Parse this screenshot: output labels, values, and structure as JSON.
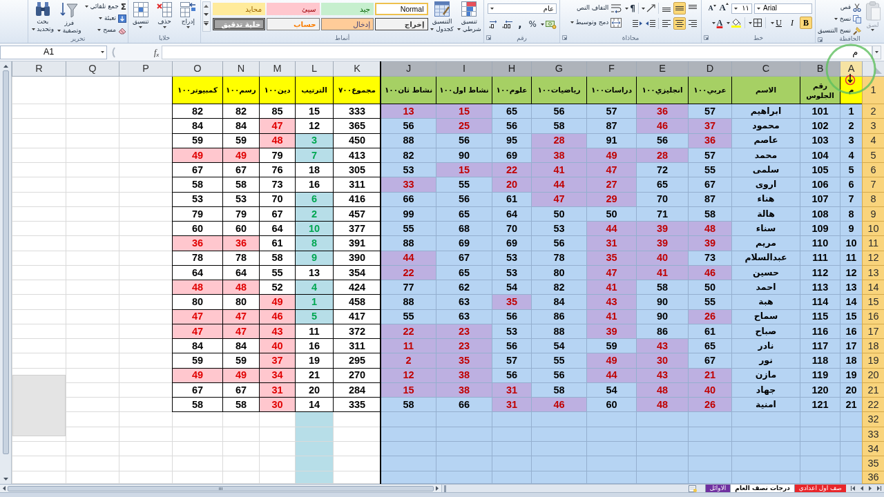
{
  "ribbon": {
    "clipboard": {
      "label": "الحافظة",
      "paste": {
        "label": "لصق",
        "disabled": true
      },
      "cut": "قص",
      "copy": "نسخ",
      "format_painter": "نسخ التنسيق"
    },
    "font": {
      "label": "خط",
      "font_name": "Arial",
      "font_size": "١١",
      "grow": "A",
      "shrink": "A",
      "bold": {
        "glyph": "B",
        "on": true
      },
      "italic": {
        "glyph": "I",
        "on": false
      },
      "underline": {
        "glyph": "U",
        "on": false
      },
      "font_color": "A"
    },
    "alignment": {
      "label": "محاذاة",
      "vertical": [
        {
          "kind": "top",
          "selected": false
        },
        {
          "kind": "middle",
          "selected": true
        },
        {
          "kind": "bottom",
          "selected": false
        }
      ],
      "horizontal": [
        {
          "kind": "right",
          "selected": false
        },
        {
          "kind": "center",
          "selected": true
        },
        {
          "kind": "left",
          "selected": false
        }
      ],
      "direction": "¶",
      "wrap_text": "التفاف النص",
      "merge_center": "دمج وتوسيط"
    },
    "number": {
      "label": "رقم",
      "format": "عام",
      "percent": "%",
      "comma": ","
    },
    "styles": {
      "label": "أنماط",
      "conditional_formatting": "تنسيق شرطي",
      "format_as_table": "التنسيق كجدول",
      "gallery": [
        {
          "label": "Normal",
          "kind": "normal",
          "selected": true
        },
        {
          "label": "جيد",
          "kind": "good",
          "selected": false
        },
        {
          "label": "سيئ",
          "kind": "bad",
          "selected": false
        },
        {
          "label": "محايد",
          "kind": "neutral",
          "selected": false
        },
        {
          "label": "إخراج",
          "kind": "output",
          "selected": false
        },
        {
          "label": "إدخال",
          "kind": "input",
          "selected": false
        },
        {
          "label": "حساب",
          "kind": "calculation",
          "selected": false
        },
        {
          "label": "خلية تدقيق",
          "kind": "check",
          "selected": false
        }
      ]
    },
    "cells": {
      "label": "خلايا",
      "insert": "إدراج",
      "delete": "حذف",
      "format": "تنسيق"
    },
    "editing": {
      "label": "تحرير",
      "autosum": {
        "glyph": "Σ",
        "label": "جمع تلقائي"
      },
      "fill": "تعبئة",
      "clear": "مسح",
      "sort_filter": "فرز وتصفية",
      "find_select": "بحث وتحديد"
    }
  },
  "formula_bar": {
    "name_box": "A1",
    "function_label": "f$_{x}$",
    "value": "م"
  },
  "sheet": {
    "columns": [
      {
        "letter": "A",
        "kind": "serial",
        "selected": true,
        "active": true
      },
      {
        "letter": "B",
        "kind": "info",
        "selected": true,
        "active": false
      },
      {
        "letter": "C",
        "kind": "name",
        "selected": true,
        "active": false
      },
      {
        "letter": "D",
        "kind": "subject",
        "selected": true,
        "active": false
      },
      {
        "letter": "E",
        "kind": "subject",
        "selected": true,
        "active": false
      },
      {
        "letter": "F",
        "kind": "subject",
        "selected": true,
        "active": false
      },
      {
        "letter": "G",
        "kind": "subject",
        "selected": true,
        "active": false
      },
      {
        "letter": "H",
        "kind": "subject",
        "selected": true,
        "active": false
      },
      {
        "letter": "I",
        "kind": "subject",
        "selected": true,
        "active": false
      },
      {
        "letter": "J",
        "kind": "subject",
        "selected": true,
        "active": false
      },
      {
        "letter": "K",
        "kind": "total",
        "selected": false,
        "active": false
      },
      {
        "letter": "L",
        "kind": "rank",
        "selected": false,
        "active": false
      },
      {
        "letter": "M",
        "kind": "extra",
        "selected": false,
        "active": false
      },
      {
        "letter": "N",
        "kind": "extra",
        "selected": false,
        "active": false
      },
      {
        "letter": "O",
        "kind": "extra",
        "selected": false,
        "active": false
      },
      {
        "letter": "P",
        "kind": "blank",
        "selected": false,
        "active": false
      },
      {
        "letter": "Q",
        "kind": "blank",
        "selected": false,
        "active": false
      },
      {
        "letter": "R",
        "kind": "blank",
        "selected": false,
        "active": false
      }
    ],
    "header_row": {
      "number": "1",
      "selected": true,
      "cells": [
        "م",
        "رقم الجلوس",
        "الاسم",
        "عربي١٠٠",
        "انجليزي١٠٠",
        "دراسات١٠٠",
        "رياضيات١٠٠",
        "علوم١٠٠",
        "نشاط اول١٠٠",
        "نشاط ثان١٠٠",
        "مجموع٧٠٠",
        "الترتيب",
        "دين١٠٠",
        "رسم١٠٠",
        "كمبيوتر١٠٠"
      ]
    },
    "rows": [
      {
        "number": "2",
        "selected": true,
        "cells": [
          {
            "text": "1",
            "highlighted": false
          },
          {
            "text": "101",
            "highlighted": false
          },
          {
            "text": "ابراهيم",
            "highlighted": false
          },
          {
            "text": "57",
            "highlighted": false
          },
          {
            "text": "36",
            "highlighted": true
          },
          {
            "text": "57",
            "highlighted": false
          },
          {
            "text": "56",
            "highlighted": false
          },
          {
            "text": "65",
            "highlighted": false
          },
          {
            "text": "15",
            "highlighted": true
          },
          {
            "text": "13",
            "highlighted": true
          },
          {
            "text": "333",
            "highlighted": false
          },
          {
            "text": "15",
            "highlighted": false
          },
          {
            "text": "85",
            "highlighted": false
          },
          {
            "text": "82",
            "highlighted": false
          },
          {
            "text": "82",
            "highlighted": false
          }
        ]
      },
      {
        "number": "3",
        "selected": true,
        "cells": [
          {
            "text": "2",
            "highlighted": false
          },
          {
            "text": "102",
            "highlighted": false
          },
          {
            "text": "محمود",
            "highlighted": false
          },
          {
            "text": "37",
            "highlighted": true
          },
          {
            "text": "46",
            "highlighted": true
          },
          {
            "text": "87",
            "highlighted": false
          },
          {
            "text": "58",
            "highlighted": false
          },
          {
            "text": "56",
            "highlighted": false
          },
          {
            "text": "25",
            "highlighted": true
          },
          {
            "text": "56",
            "highlighted": false
          },
          {
            "text": "365",
            "highlighted": false
          },
          {
            "text": "12",
            "highlighted": false
          },
          {
            "text": "47",
            "highlighted": true
          },
          {
            "text": "84",
            "highlighted": false
          },
          {
            "text": "84",
            "highlighted": false
          }
        ]
      },
      {
        "number": "4",
        "selected": true,
        "cells": [
          {
            "text": "3",
            "highlighted": false
          },
          {
            "text": "103",
            "highlighted": false
          },
          {
            "text": "عاصم",
            "highlighted": false
          },
          {
            "text": "36",
            "highlighted": true
          },
          {
            "text": "56",
            "highlighted": false
          },
          {
            "text": "91",
            "highlighted": false
          },
          {
            "text": "28",
            "highlighted": true
          },
          {
            "text": "95",
            "highlighted": false
          },
          {
            "text": "56",
            "highlighted": false
          },
          {
            "text": "88",
            "highlighted": false
          },
          {
            "text": "450",
            "highlighted": false
          },
          {
            "text": "3",
            "highlighted": true
          },
          {
            "text": "48",
            "highlighted": true
          },
          {
            "text": "59",
            "highlighted": false
          },
          {
            "text": "59",
            "highlighted": false
          }
        ]
      },
      {
        "number": "5",
        "selected": true,
        "cells": [
          {
            "text": "4",
            "highlighted": false
          },
          {
            "text": "104",
            "highlighted": false
          },
          {
            "text": "محمد",
            "highlighted": false
          },
          {
            "text": "57",
            "highlighted": false
          },
          {
            "text": "28",
            "highlighted": true
          },
          {
            "text": "49",
            "highlighted": true
          },
          {
            "text": "38",
            "highlighted": true
          },
          {
            "text": "69",
            "highlighted": false
          },
          {
            "text": "90",
            "highlighted": false
          },
          {
            "text": "82",
            "highlighted": false
          },
          {
            "text": "413",
            "highlighted": false
          },
          {
            "text": "7",
            "highlighted": true
          },
          {
            "text": "79",
            "highlighted": false
          },
          {
            "text": "49",
            "highlighted": true
          },
          {
            "text": "49",
            "highlighted": true
          }
        ]
      },
      {
        "number": "6",
        "selected": true,
        "cells": [
          {
            "text": "5",
            "highlighted": false
          },
          {
            "text": "105",
            "highlighted": false
          },
          {
            "text": "سلمى",
            "highlighted": false
          },
          {
            "text": "55",
            "highlighted": false
          },
          {
            "text": "72",
            "highlighted": false
          },
          {
            "text": "47",
            "highlighted": true
          },
          {
            "text": "41",
            "highlighted": true
          },
          {
            "text": "22",
            "highlighted": true
          },
          {
            "text": "15",
            "highlighted": true
          },
          {
            "text": "53",
            "highlighted": false
          },
          {
            "text": "305",
            "highlighted": false
          },
          {
            "text": "18",
            "highlighted": false
          },
          {
            "text": "76",
            "highlighted": false
          },
          {
            "text": "67",
            "highlighted": false
          },
          {
            "text": "67",
            "highlighted": false
          }
        ]
      },
      {
        "number": "7",
        "selected": true,
        "cells": [
          {
            "text": "6",
            "highlighted": false
          },
          {
            "text": "106",
            "highlighted": false
          },
          {
            "text": "اروى",
            "highlighted": false
          },
          {
            "text": "67",
            "highlighted": false
          },
          {
            "text": "65",
            "highlighted": false
          },
          {
            "text": "27",
            "highlighted": true
          },
          {
            "text": "44",
            "highlighted": true
          },
          {
            "text": "20",
            "highlighted": true
          },
          {
            "text": "55",
            "highlighted": false
          },
          {
            "text": "33",
            "highlighted": true
          },
          {
            "text": "311",
            "highlighted": false
          },
          {
            "text": "16",
            "highlighted": false
          },
          {
            "text": "73",
            "highlighted": false
          },
          {
            "text": "58",
            "highlighted": false
          },
          {
            "text": "58",
            "highlighted": false
          }
        ]
      },
      {
        "number": "8",
        "selected": true,
        "cells": [
          {
            "text": "7",
            "highlighted": false
          },
          {
            "text": "107",
            "highlighted": false
          },
          {
            "text": "هناء",
            "highlighted": false
          },
          {
            "text": "87",
            "highlighted": false
          },
          {
            "text": "70",
            "highlighted": false
          },
          {
            "text": "29",
            "highlighted": true
          },
          {
            "text": "47",
            "highlighted": true
          },
          {
            "text": "61",
            "highlighted": false
          },
          {
            "text": "56",
            "highlighted": false
          },
          {
            "text": "66",
            "highlighted": false
          },
          {
            "text": "416",
            "highlighted": false
          },
          {
            "text": "6",
            "highlighted": true
          },
          {
            "text": "70",
            "highlighted": false
          },
          {
            "text": "53",
            "highlighted": false
          },
          {
            "text": "53",
            "highlighted": false
          }
        ]
      },
      {
        "number": "9",
        "selected": true,
        "cells": [
          {
            "text": "8",
            "highlighted": false
          },
          {
            "text": "108",
            "highlighted": false
          },
          {
            "text": "هالة",
            "highlighted": false
          },
          {
            "text": "58",
            "highlighted": false
          },
          {
            "text": "71",
            "highlighted": false
          },
          {
            "text": "50",
            "highlighted": false
          },
          {
            "text": "50",
            "highlighted": false
          },
          {
            "text": "64",
            "highlighted": false
          },
          {
            "text": "65",
            "highlighted": false
          },
          {
            "text": "99",
            "highlighted": false
          },
          {
            "text": "457",
            "highlighted": false
          },
          {
            "text": "2",
            "highlighted": true
          },
          {
            "text": "67",
            "highlighted": false
          },
          {
            "text": "79",
            "highlighted": false
          },
          {
            "text": "79",
            "highlighted": false
          }
        ]
      },
      {
        "number": "10",
        "selected": true,
        "cells": [
          {
            "text": "9",
            "highlighted": false
          },
          {
            "text": "109",
            "highlighted": false
          },
          {
            "text": "سناء",
            "highlighted": false
          },
          {
            "text": "48",
            "highlighted": true
          },
          {
            "text": "39",
            "highlighted": true
          },
          {
            "text": "44",
            "highlighted": true
          },
          {
            "text": "53",
            "highlighted": false
          },
          {
            "text": "70",
            "highlighted": false
          },
          {
            "text": "68",
            "highlighted": false
          },
          {
            "text": "55",
            "highlighted": false
          },
          {
            "text": "377",
            "highlighted": false
          },
          {
            "text": "10",
            "highlighted": true
          },
          {
            "text": "64",
            "highlighted": false
          },
          {
            "text": "60",
            "highlighted": false
          },
          {
            "text": "60",
            "highlighted": false
          }
        ]
      },
      {
        "number": "11",
        "selected": true,
        "cells": [
          {
            "text": "10",
            "highlighted": false
          },
          {
            "text": "110",
            "highlighted": false
          },
          {
            "text": "مريم",
            "highlighted": false
          },
          {
            "text": "39",
            "highlighted": true
          },
          {
            "text": "39",
            "highlighted": true
          },
          {
            "text": "31",
            "highlighted": true
          },
          {
            "text": "56",
            "highlighted": false
          },
          {
            "text": "69",
            "highlighted": false
          },
          {
            "text": "69",
            "highlighted": false
          },
          {
            "text": "88",
            "highlighted": false
          },
          {
            "text": "391",
            "highlighted": false
          },
          {
            "text": "8",
            "highlighted": true
          },
          {
            "text": "61",
            "highlighted": false
          },
          {
            "text": "36",
            "highlighted": true
          },
          {
            "text": "36",
            "highlighted": true
          }
        ]
      },
      {
        "number": "12",
        "selected": true,
        "cells": [
          {
            "text": "11",
            "highlighted": false
          },
          {
            "text": "111",
            "highlighted": false
          },
          {
            "text": "عبدالسلام",
            "highlighted": false
          },
          {
            "text": "73",
            "highlighted": false
          },
          {
            "text": "40",
            "highlighted": true
          },
          {
            "text": "35",
            "highlighted": true
          },
          {
            "text": "78",
            "highlighted": false
          },
          {
            "text": "53",
            "highlighted": false
          },
          {
            "text": "67",
            "highlighted": false
          },
          {
            "text": "44",
            "highlighted": true
          },
          {
            "text": "390",
            "highlighted": false
          },
          {
            "text": "9",
            "highlighted": true
          },
          {
            "text": "58",
            "highlighted": false
          },
          {
            "text": "78",
            "highlighted": false
          },
          {
            "text": "78",
            "highlighted": false
          }
        ]
      },
      {
        "number": "13",
        "selected": true,
        "cells": [
          {
            "text": "12",
            "highlighted": false
          },
          {
            "text": "112",
            "highlighted": false
          },
          {
            "text": "حسين",
            "highlighted": false
          },
          {
            "text": "46",
            "highlighted": true
          },
          {
            "text": "41",
            "highlighted": true
          },
          {
            "text": "47",
            "highlighted": true
          },
          {
            "text": "80",
            "highlighted": false
          },
          {
            "text": "53",
            "highlighted": false
          },
          {
            "text": "65",
            "highlighted": false
          },
          {
            "text": "22",
            "highlighted": true
          },
          {
            "text": "354",
            "highlighted": false
          },
          {
            "text": "13",
            "highlighted": false
          },
          {
            "text": "55",
            "highlighted": false
          },
          {
            "text": "64",
            "highlighted": false
          },
          {
            "text": "64",
            "highlighted": false
          }
        ]
      },
      {
        "number": "14",
        "selected": true,
        "cells": [
          {
            "text": "13",
            "highlighted": false
          },
          {
            "text": "113",
            "highlighted": false
          },
          {
            "text": "احمد",
            "highlighted": false
          },
          {
            "text": "50",
            "highlighted": false
          },
          {
            "text": "58",
            "highlighted": false
          },
          {
            "text": "41",
            "highlighted": true
          },
          {
            "text": "82",
            "highlighted": false
          },
          {
            "text": "54",
            "highlighted": false
          },
          {
            "text": "62",
            "highlighted": false
          },
          {
            "text": "77",
            "highlighted": false
          },
          {
            "text": "424",
            "highlighted": false
          },
          {
            "text": "4",
            "highlighted": true
          },
          {
            "text": "52",
            "highlighted": false
          },
          {
            "text": "48",
            "highlighted": true
          },
          {
            "text": "48",
            "highlighted": true
          }
        ]
      },
      {
        "number": "15",
        "selected": true,
        "cells": [
          {
            "text": "14",
            "highlighted": false
          },
          {
            "text": "114",
            "highlighted": false
          },
          {
            "text": "هبة",
            "highlighted": false
          },
          {
            "text": "55",
            "highlighted": false
          },
          {
            "text": "90",
            "highlighted": false
          },
          {
            "text": "43",
            "highlighted": true
          },
          {
            "text": "84",
            "highlighted": false
          },
          {
            "text": "35",
            "highlighted": true
          },
          {
            "text": "63",
            "highlighted": false
          },
          {
            "text": "88",
            "highlighted": false
          },
          {
            "text": "458",
            "highlighted": false
          },
          {
            "text": "1",
            "highlighted": true
          },
          {
            "text": "49",
            "highlighted": true
          },
          {
            "text": "80",
            "highlighted": false
          },
          {
            "text": "80",
            "highlighted": false
          }
        ]
      },
      {
        "number": "16",
        "selected": true,
        "cells": [
          {
            "text": "15",
            "highlighted": false
          },
          {
            "text": "115",
            "highlighted": false
          },
          {
            "text": "سماح",
            "highlighted": false
          },
          {
            "text": "26",
            "highlighted": true
          },
          {
            "text": "90",
            "highlighted": false
          },
          {
            "text": "41",
            "highlighted": true
          },
          {
            "text": "86",
            "highlighted": false
          },
          {
            "text": "56",
            "highlighted": false
          },
          {
            "text": "63",
            "highlighted": false
          },
          {
            "text": "55",
            "highlighted": false
          },
          {
            "text": "417",
            "highlighted": false
          },
          {
            "text": "5",
            "highlighted": true
          },
          {
            "text": "46",
            "highlighted": true
          },
          {
            "text": "47",
            "highlighted": true
          },
          {
            "text": "47",
            "highlighted": true
          }
        ]
      },
      {
        "number": "17",
        "selected": true,
        "cells": [
          {
            "text": "16",
            "highlighted": false
          },
          {
            "text": "116",
            "highlighted": false
          },
          {
            "text": "صباح",
            "highlighted": false
          },
          {
            "text": "61",
            "highlighted": false
          },
          {
            "text": "86",
            "highlighted": false
          },
          {
            "text": "39",
            "highlighted": true
          },
          {
            "text": "88",
            "highlighted": false
          },
          {
            "text": "53",
            "highlighted": false
          },
          {
            "text": "23",
            "highlighted": true
          },
          {
            "text": "22",
            "highlighted": true
          },
          {
            "text": "372",
            "highlighted": false
          },
          {
            "text": "11",
            "highlighted": false
          },
          {
            "text": "43",
            "highlighted": true
          },
          {
            "text": "47",
            "highlighted": true
          },
          {
            "text": "47",
            "highlighted": true
          }
        ]
      },
      {
        "number": "18",
        "selected": true,
        "cells": [
          {
            "text": "17",
            "highlighted": false
          },
          {
            "text": "117",
            "highlighted": false
          },
          {
            "text": "نادر",
            "highlighted": false
          },
          {
            "text": "65",
            "highlighted": false
          },
          {
            "text": "43",
            "highlighted": true
          },
          {
            "text": "59",
            "highlighted": false
          },
          {
            "text": "54",
            "highlighted": false
          },
          {
            "text": "56",
            "highlighted": false
          },
          {
            "text": "23",
            "highlighted": true
          },
          {
            "text": "11",
            "highlighted": true
          },
          {
            "text": "311",
            "highlighted": false
          },
          {
            "text": "16",
            "highlighted": false
          },
          {
            "text": "40",
            "highlighted": true
          },
          {
            "text": "84",
            "highlighted": false
          },
          {
            "text": "84",
            "highlighted": false
          }
        ]
      },
      {
        "number": "19",
        "selected": true,
        "cells": [
          {
            "text": "18",
            "highlighted": false
          },
          {
            "text": "118",
            "highlighted": false
          },
          {
            "text": "نور",
            "highlighted": false
          },
          {
            "text": "67",
            "highlighted": false
          },
          {
            "text": "30",
            "highlighted": true
          },
          {
            "text": "49",
            "highlighted": true
          },
          {
            "text": "55",
            "highlighted": false
          },
          {
            "text": "57",
            "highlighted": false
          },
          {
            "text": "35",
            "highlighted": true
          },
          {
            "text": "2",
            "highlighted": true
          },
          {
            "text": "295",
            "highlighted": false
          },
          {
            "text": "19",
            "highlighted": false
          },
          {
            "text": "37",
            "highlighted": true
          },
          {
            "text": "59",
            "highlighted": false
          },
          {
            "text": "59",
            "highlighted": false
          }
        ]
      },
      {
        "number": "20",
        "selected": true,
        "cells": [
          {
            "text": "19",
            "highlighted": false
          },
          {
            "text": "119",
            "highlighted": false
          },
          {
            "text": "مازن",
            "highlighted": false
          },
          {
            "text": "21",
            "highlighted": true
          },
          {
            "text": "43",
            "highlighted": true
          },
          {
            "text": "44",
            "highlighted": true
          },
          {
            "text": "56",
            "highlighted": false
          },
          {
            "text": "56",
            "highlighted": false
          },
          {
            "text": "38",
            "highlighted": true
          },
          {
            "text": "12",
            "highlighted": true
          },
          {
            "text": "270",
            "highlighted": false
          },
          {
            "text": "21",
            "highlighted": false
          },
          {
            "text": "34",
            "highlighted": true
          },
          {
            "text": "49",
            "highlighted": true
          },
          {
            "text": "49",
            "highlighted": true
          }
        ]
      },
      {
        "number": "21",
        "selected": true,
        "cells": [
          {
            "text": "20",
            "highlighted": false
          },
          {
            "text": "120",
            "highlighted": false
          },
          {
            "text": "جهاد",
            "highlighted": false
          },
          {
            "text": "40",
            "highlighted": true
          },
          {
            "text": "48",
            "highlighted": true
          },
          {
            "text": "54",
            "highlighted": false
          },
          {
            "text": "58",
            "highlighted": false
          },
          {
            "text": "31",
            "highlighted": true
          },
          {
            "text": "38",
            "highlighted": true
          },
          {
            "text": "15",
            "highlighted": true
          },
          {
            "text": "284",
            "highlighted": false
          },
          {
            "text": "20",
            "highlighted": false
          },
          {
            "text": "31",
            "highlighted": true
          },
          {
            "text": "67",
            "highlighted": false
          },
          {
            "text": "67",
            "highlighted": false
          }
        ]
      },
      {
        "number": "22",
        "selected": true,
        "cells": [
          {
            "text": "21",
            "highlighted": false
          },
          {
            "text": "121",
            "highlighted": false
          },
          {
            "text": "امنية",
            "highlighted": false
          },
          {
            "text": "26",
            "highlighted": true
          },
          {
            "text": "48",
            "highlighted": true
          },
          {
            "text": "60",
            "highlighted": false
          },
          {
            "text": "46",
            "highlighted": true
          },
          {
            "text": "31",
            "highlighted": true
          },
          {
            "text": "66",
            "highlighted": false
          },
          {
            "text": "58",
            "highlighted": false
          },
          {
            "text": "335",
            "highlighted": false
          },
          {
            "text": "14",
            "highlighted": false
          },
          {
            "text": "30",
            "highlighted": true
          },
          {
            "text": "58",
            "highlighted": false
          },
          {
            "text": "58",
            "highlighted": false
          }
        ]
      }
    ],
    "blank_rows": [
      {
        "number": "32",
        "selected": true,
        "cells": [
          {
            "highlighted": false
          },
          {
            "highlighted": false
          },
          {
            "highlighted": false
          },
          {
            "highlighted": false
          },
          {
            "highlighted": false
          },
          {
            "highlighted": false
          },
          {
            "highlighted": false
          },
          {
            "highlighted": false
          },
          {
            "highlighted": false
          },
          {
            "highlighted": false
          },
          {
            "highlighted": false
          },
          {
            "highlighted": true
          },
          {
            "highlighted": false
          },
          {
            "highlighted": false
          },
          {
            "highlighted": false
          }
        ]
      },
      {
        "number": "33",
        "selected": true,
        "cells": [
          {
            "highlighted": false
          },
          {
            "highlighted": false
          },
          {
            "highlighted": false
          },
          {
            "highlighted": false
          },
          {
            "highlighted": false
          },
          {
            "highlighted": false
          },
          {
            "highlighted": false
          },
          {
            "highlighted": false
          },
          {
            "highlighted": false
          },
          {
            "highlighted": false
          },
          {
            "highlighted": false
          },
          {
            "highlighted": true
          },
          {
            "highlighted": false
          },
          {
            "highlighted": false
          },
          {
            "highlighted": false
          }
        ]
      },
      {
        "number": "34",
        "selected": true,
        "cells": [
          {
            "highlighted": false
          },
          {
            "highlighted": false
          },
          {
            "highlighted": false
          },
          {
            "highlighted": false
          },
          {
            "highlighted": false
          },
          {
            "highlighted": false
          },
          {
            "highlighted": false
          },
          {
            "highlighted": false
          },
          {
            "highlighted": false
          },
          {
            "highlighted": false
          },
          {
            "highlighted": false
          },
          {
            "highlighted": true
          },
          {
            "highlighted": false
          },
          {
            "highlighted": false
          },
          {
            "highlighted": false
          }
        ]
      },
      {
        "number": "35",
        "selected": true,
        "cells": [
          {
            "highlighted": false
          },
          {
            "highlighted": false
          },
          {
            "highlighted": false
          },
          {
            "highlighted": false
          },
          {
            "highlighted": false
          },
          {
            "highlighted": false
          },
          {
            "highlighted": false
          },
          {
            "highlighted": false
          },
          {
            "highlighted": false
          },
          {
            "highlighted": false
          },
          {
            "highlighted": false
          },
          {
            "highlighted": true
          },
          {
            "highlighted": false
          },
          {
            "highlighted": false
          },
          {
            "highlighted": false
          }
        ]
      },
      {
        "number": "36",
        "selected": true,
        "cells": [
          {
            "highlighted": false
          },
          {
            "highlighted": false
          },
          {
            "highlighted": false
          },
          {
            "highlighted": false
          },
          {
            "highlighted": false
          },
          {
            "highlighted": false
          },
          {
            "highlighted": false
          },
          {
            "highlighted": false
          },
          {
            "highlighted": false
          },
          {
            "highlighted": false
          },
          {
            "highlighted": false
          },
          {
            "highlighted": true
          },
          {
            "highlighted": false
          },
          {
            "highlighted": false
          },
          {
            "highlighted": false
          }
        ]
      }
    ]
  },
  "sheet_tabs": [
    {
      "label": "صف اول اعدادي",
      "selected": false,
      "color": "#e8262a"
    },
    {
      "label": "درجات نصف العام",
      "selected": true
    },
    {
      "label": "الاوائل",
      "selected": false,
      "color": "#7030a0"
    }
  ]
}
